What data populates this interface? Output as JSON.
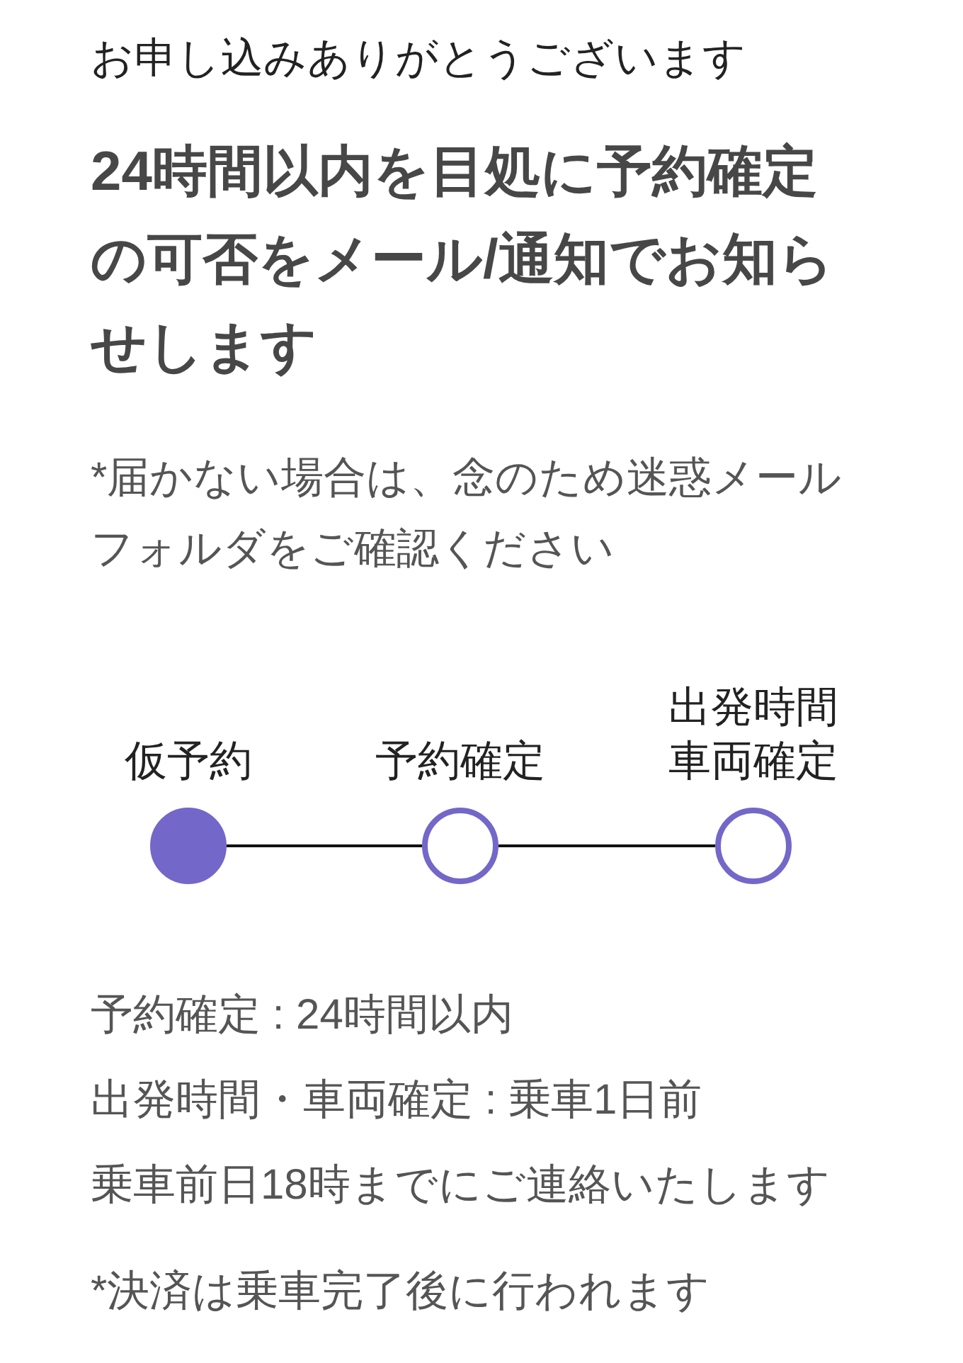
{
  "greeting": "お申し込みありがとうございます",
  "heading": "24時間以内を目処に予約確定の可否をメール/通知でお知らせします",
  "note": "*届かない場合は、念のため迷惑メールフォルダをご確認ください",
  "steps": [
    {
      "label": "仮予約",
      "done": true
    },
    {
      "label": "予約確定",
      "done": false
    },
    {
      "label": "出発時間車両確定",
      "done": false
    }
  ],
  "details": [
    "予約確定 : 24時間以内",
    "出発時間・車両確定 : 乗車1日前",
    "乗車前日18時までにご連絡いたします"
  ],
  "payment_note": "*決済は乗車完了後に行われます"
}
